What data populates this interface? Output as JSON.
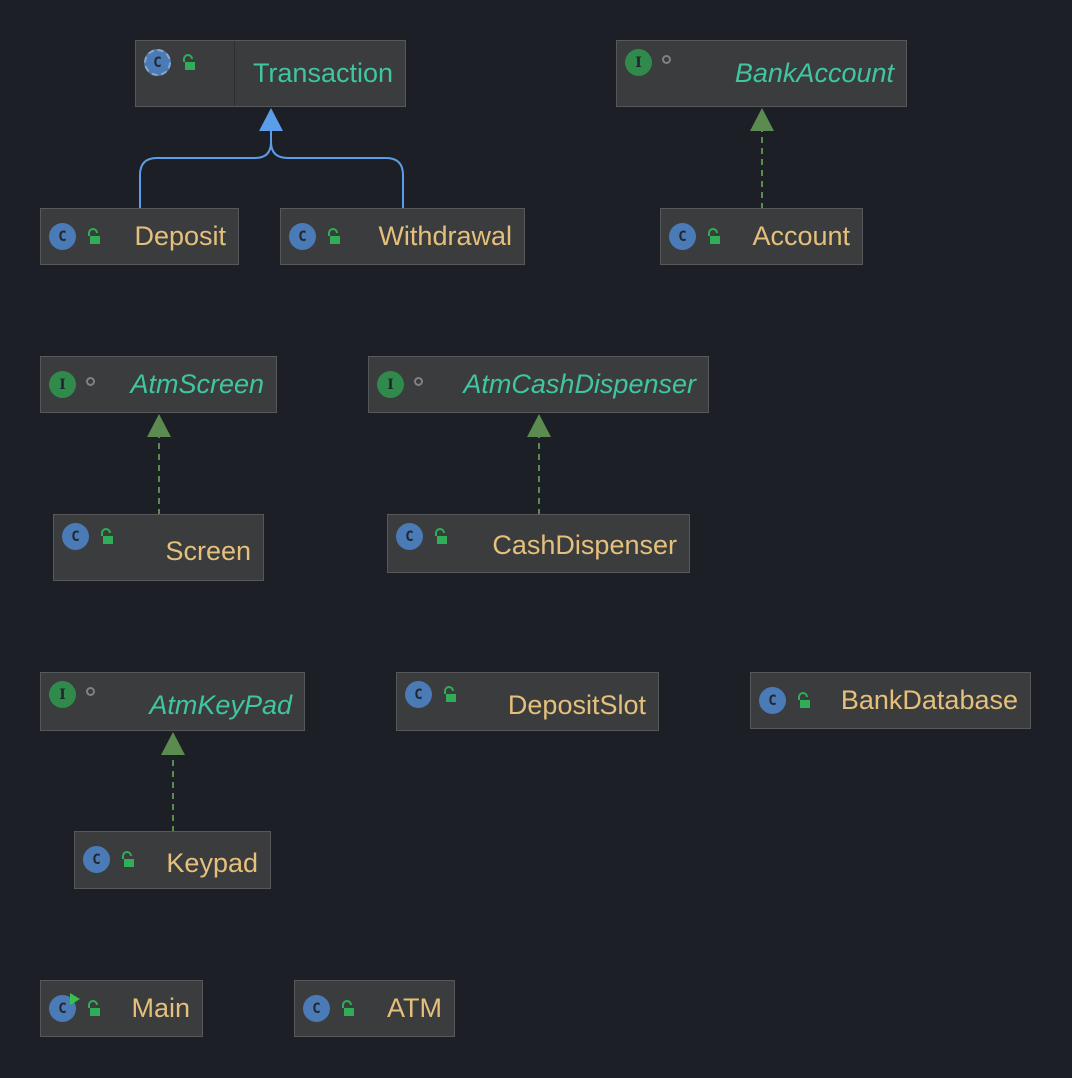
{
  "diagram": {
    "colors": {
      "background": "#1d1f26",
      "node_fill": "#3b3c3e",
      "class_text": "#e5c07b",
      "interface_text": "#3fc6a1",
      "extends_edge": "#5a9de8",
      "implements_edge": "#5c8b4f"
    },
    "nodes": [
      {
        "id": "transaction",
        "label": "Transaction",
        "kind": "abstract",
        "icon": "abstract-class-icon",
        "visibility": "public-lock-icon"
      },
      {
        "id": "bankaccount",
        "label": "BankAccount",
        "kind": "interface",
        "icon": "interface-icon",
        "visibility": "package-dot-icon"
      },
      {
        "id": "deposit",
        "label": "Deposit",
        "kind": "class",
        "icon": "class-icon",
        "visibility": "public-lock-icon"
      },
      {
        "id": "withdrawal",
        "label": "Withdrawal",
        "kind": "class",
        "icon": "class-icon",
        "visibility": "public-lock-icon"
      },
      {
        "id": "account",
        "label": "Account",
        "kind": "class",
        "icon": "class-icon",
        "visibility": "public-lock-icon"
      },
      {
        "id": "atmscreen",
        "label": "AtmScreen",
        "kind": "interface",
        "icon": "interface-icon",
        "visibility": "package-dot-icon"
      },
      {
        "id": "atmcashdispenser",
        "label": "AtmCashDispenser",
        "kind": "interface",
        "icon": "interface-icon",
        "visibility": "package-dot-icon"
      },
      {
        "id": "screen",
        "label": "Screen",
        "kind": "class",
        "icon": "class-icon",
        "visibility": "public-lock-icon"
      },
      {
        "id": "cashdispenser",
        "label": "CashDispenser",
        "kind": "class",
        "icon": "class-icon",
        "visibility": "public-lock-icon"
      },
      {
        "id": "atmkeypad",
        "label": "AtmKeyPad",
        "kind": "interface",
        "icon": "interface-icon",
        "visibility": "package-dot-icon"
      },
      {
        "id": "depositslot",
        "label": "DepositSlot",
        "kind": "class",
        "icon": "class-icon",
        "visibility": "public-lock-icon"
      },
      {
        "id": "bankdatabase",
        "label": "BankDatabase",
        "kind": "class",
        "icon": "class-icon",
        "visibility": "public-lock-icon"
      },
      {
        "id": "keypad",
        "label": "Keypad",
        "kind": "class",
        "icon": "class-icon",
        "visibility": "public-lock-icon"
      },
      {
        "id": "main",
        "label": "Main",
        "kind": "class",
        "icon": "runnable-class-icon",
        "visibility": "public-lock-icon"
      },
      {
        "id": "atm",
        "label": "ATM",
        "kind": "class",
        "icon": "class-icon",
        "visibility": "public-lock-icon"
      }
    ],
    "edges": [
      {
        "from": "deposit",
        "to": "transaction",
        "type": "extends"
      },
      {
        "from": "withdrawal",
        "to": "transaction",
        "type": "extends"
      },
      {
        "from": "account",
        "to": "bankaccount",
        "type": "implements"
      },
      {
        "from": "screen",
        "to": "atmscreen",
        "type": "implements"
      },
      {
        "from": "cashdispenser",
        "to": "atmcashdispenser",
        "type": "implements"
      },
      {
        "from": "keypad",
        "to": "atmkeypad",
        "type": "implements"
      }
    ]
  }
}
